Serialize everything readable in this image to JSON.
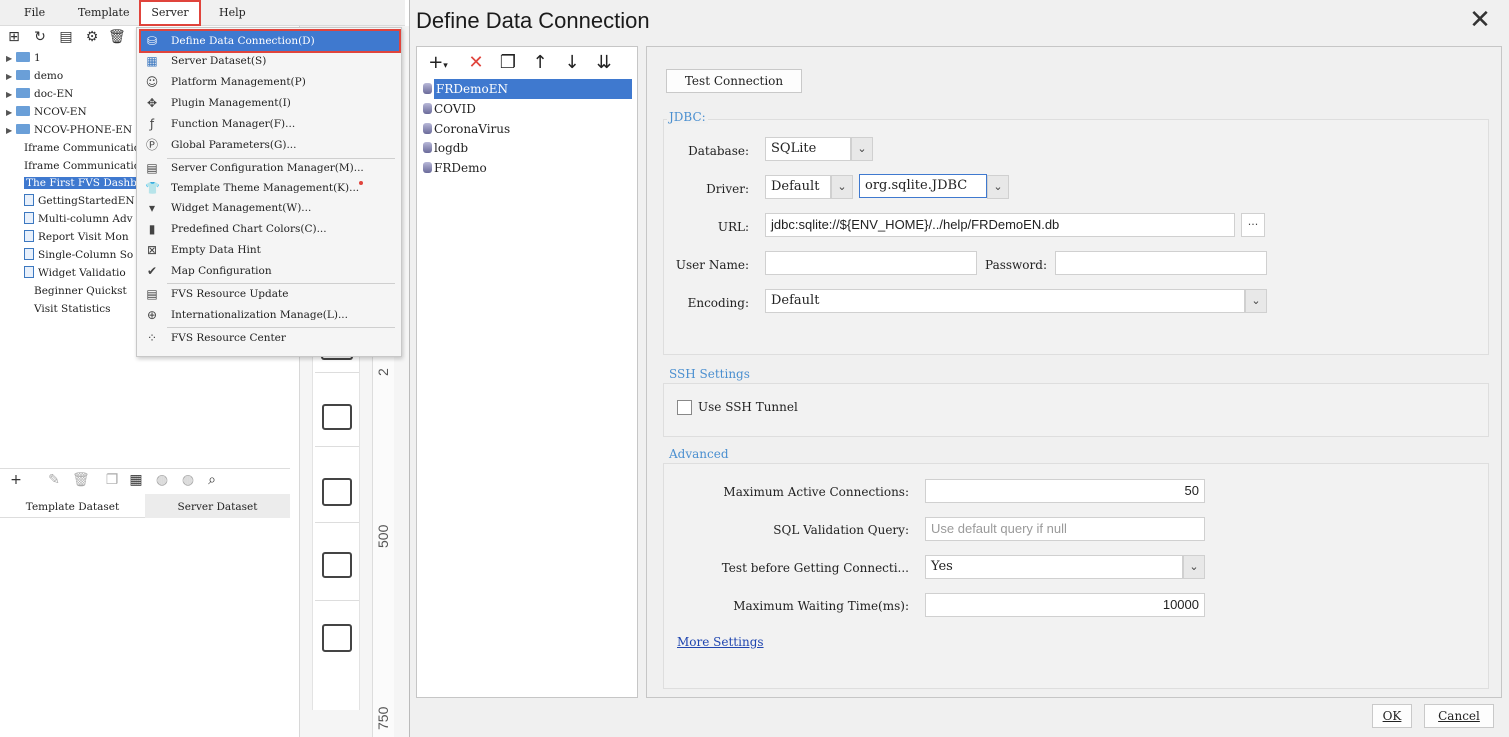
{
  "menubar": {
    "file": "File",
    "template": "Template",
    "server": "Server",
    "help": "Help"
  },
  "tree": {
    "items": [
      {
        "label": "1",
        "type": "folder"
      },
      {
        "label": "demo",
        "type": "folder"
      },
      {
        "label": "doc-EN",
        "type": "folder"
      },
      {
        "label": "NCOV-EN",
        "type": "folder"
      },
      {
        "label": "NCOV-PHONE-EN",
        "type": "folder"
      },
      {
        "label": "Iframe Communicatio",
        "type": "file"
      },
      {
        "label": "Iframe Communicatio",
        "type": "file"
      },
      {
        "label": "The First FVS Dashb",
        "type": "file",
        "selected": true
      },
      {
        "label": "GettingStartedEN",
        "type": "file"
      },
      {
        "label": "Multi-column Adv",
        "type": "file"
      },
      {
        "label": "Report Visit Mon",
        "type": "file"
      },
      {
        "label": "Single-Column So",
        "type": "file"
      },
      {
        "label": "Widget Validatio",
        "type": "file"
      },
      {
        "label": "Beginner Quickst",
        "type": "file"
      },
      {
        "label": "Visit Statistics",
        "type": "file"
      }
    ]
  },
  "dataset_tabs": {
    "template": "Template Dataset",
    "server": "Server Dataset"
  },
  "ruler": {
    "mark_500": "500",
    "mark_750": "750",
    "mark_250": "2"
  },
  "server_menu": {
    "items": [
      {
        "label": "Define Data Connection(D)",
        "icon": "db-connection-icon"
      },
      {
        "label": "Server Dataset(S)",
        "icon": "dataset-icon"
      },
      {
        "label": "Platform Management(P)",
        "icon": "user-icon"
      },
      {
        "label": "Plugin Management(I)",
        "icon": "puzzle-icon"
      },
      {
        "label": "Function Manager(F)...",
        "icon": "function-icon"
      },
      {
        "label": "Global Parameters(G)...",
        "icon": "parameter-icon"
      },
      {
        "label": "Server Configuration Manager(M)...",
        "icon": "config-icon"
      },
      {
        "label": "Template Theme Management(K)...",
        "icon": "shirt-icon"
      },
      {
        "label": "Widget Management(W)...",
        "icon": "widget-icon"
      },
      {
        "label": "Predefined Chart Colors(C)...",
        "icon": "bar-chart-icon"
      },
      {
        "label": "Empty Data Hint",
        "icon": "empty-box-icon"
      },
      {
        "label": "Map Configuration",
        "icon": "map-icon"
      },
      {
        "label": "FVS Resource Update",
        "icon": "resource-icon"
      },
      {
        "label": "Internationalization Manage(L)...",
        "icon": "globe-icon"
      },
      {
        "label": "FVS Resource Center",
        "icon": "grid-icon"
      }
    ]
  },
  "dialog": {
    "title": "Define Data Connection",
    "connections": [
      "FRDemoEN",
      "COVID",
      "CoronaVirus",
      "logdb",
      "FRDemo"
    ],
    "test_connection": "Test Connection",
    "jdbc": {
      "group_title": "JDBC:",
      "database_label": "Database:",
      "database_value": "SQLite",
      "driver_label": "Driver:",
      "driver_mode": "Default",
      "driver_value": "org.sqlite.JDBC",
      "url_label": "URL:",
      "url_value": "jdbc:sqlite://${ENV_HOME}/../help/FRDemoEN.db",
      "username_label": "User Name:",
      "username_value": "",
      "password_label": "Password:",
      "password_value": "",
      "encoding_label": "Encoding:",
      "encoding_value": "Default"
    },
    "ssh": {
      "group_title": "SSH Settings",
      "use_ssh_label": "Use SSH Tunnel"
    },
    "advanced": {
      "group_title": "Advanced",
      "max_active_label": "Maximum Active Connections:",
      "max_active_value": "50",
      "sql_validation_label": "SQL Validation Query:",
      "sql_validation_placeholder": "Use default query if null",
      "test_before_label": "Test before Getting Connecti...",
      "test_before_value": "Yes",
      "max_wait_label": "Maximum Waiting Time(ms):",
      "max_wait_value": "10000",
      "more_settings": "More Settings"
    },
    "ok": "OK",
    "cancel": "Cancel"
  },
  "colors": {
    "accent_blue": "#3f79cf",
    "highlight_red": "#e0443c",
    "group_title_blue": "#4a8fd0",
    "delete_red": "#e0443c"
  }
}
